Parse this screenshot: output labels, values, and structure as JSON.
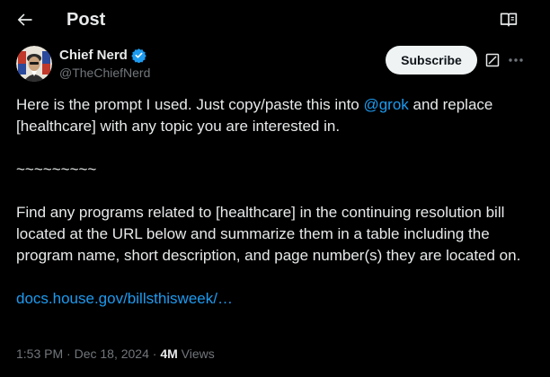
{
  "header": {
    "title": "Post"
  },
  "author": {
    "name": "Chief Nerd",
    "handle": "@TheChiefNerd",
    "subscribe_label": "Subscribe"
  },
  "post": {
    "para1_before": "Here is the prompt I used. Just copy/paste this into ",
    "mention": "@grok",
    "para1_after": " and replace [healthcare] with any topic you are interested in.",
    "separator": "~~~~~~~~~",
    "para3": "Find any programs related to [healthcare] in the continuing resolution bill located at the URL below and summarize them in a table including the program name, short description, and page number(s) they are located on.",
    "link": "docs.house.gov/billsthisweek/…"
  },
  "meta": {
    "time": "1:53 PM",
    "dot1": " · ",
    "date": "Dec 18, 2024",
    "dot2": " · ",
    "views_count": "4M",
    "views_label": " Views"
  },
  "colors": {
    "background": "#000000",
    "text": "#e7e9ea",
    "secondary": "#71767b",
    "link": "#1d9bf0",
    "verified": "#1d9bf0"
  },
  "icons": {
    "back": "arrow-left-icon",
    "reader": "book-open-icon",
    "verified": "verified-badge-icon",
    "grok": "grok-icon",
    "more": "more-horizontal-icon"
  }
}
